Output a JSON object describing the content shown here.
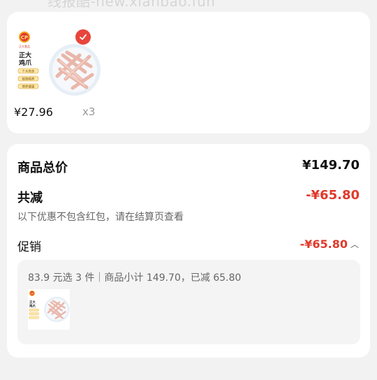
{
  "watermark": "线报酷-new.xianbao.fun",
  "product": {
    "brand_badge": "CP",
    "brand_name": "正大食品",
    "pack_title": "正大鸡爪",
    "pack_tags": [
      "个大肉多",
      "植物喂养",
      "营养健康"
    ],
    "price": "¥27.96",
    "quantity": "x3",
    "selected": true
  },
  "summary": {
    "total_label": "商品总价",
    "total_value": "¥149.70",
    "reduce_label": "共减",
    "reduce_value": "-¥65.80",
    "reduce_note": "以下优惠不包含红包，请在结算页查看",
    "promo_label": "促销",
    "promo_value": "-¥65.80",
    "promo_detail": "83.9 元选 3 件｜商品小计 149.70，已减 65.80"
  },
  "colors": {
    "accent": "#e0392b",
    "badge": "#e8453c",
    "background": "#f2f2f2",
    "card": "#ffffff"
  },
  "icons": {
    "check": "check-icon",
    "collapse": "chevron-up-icon"
  }
}
